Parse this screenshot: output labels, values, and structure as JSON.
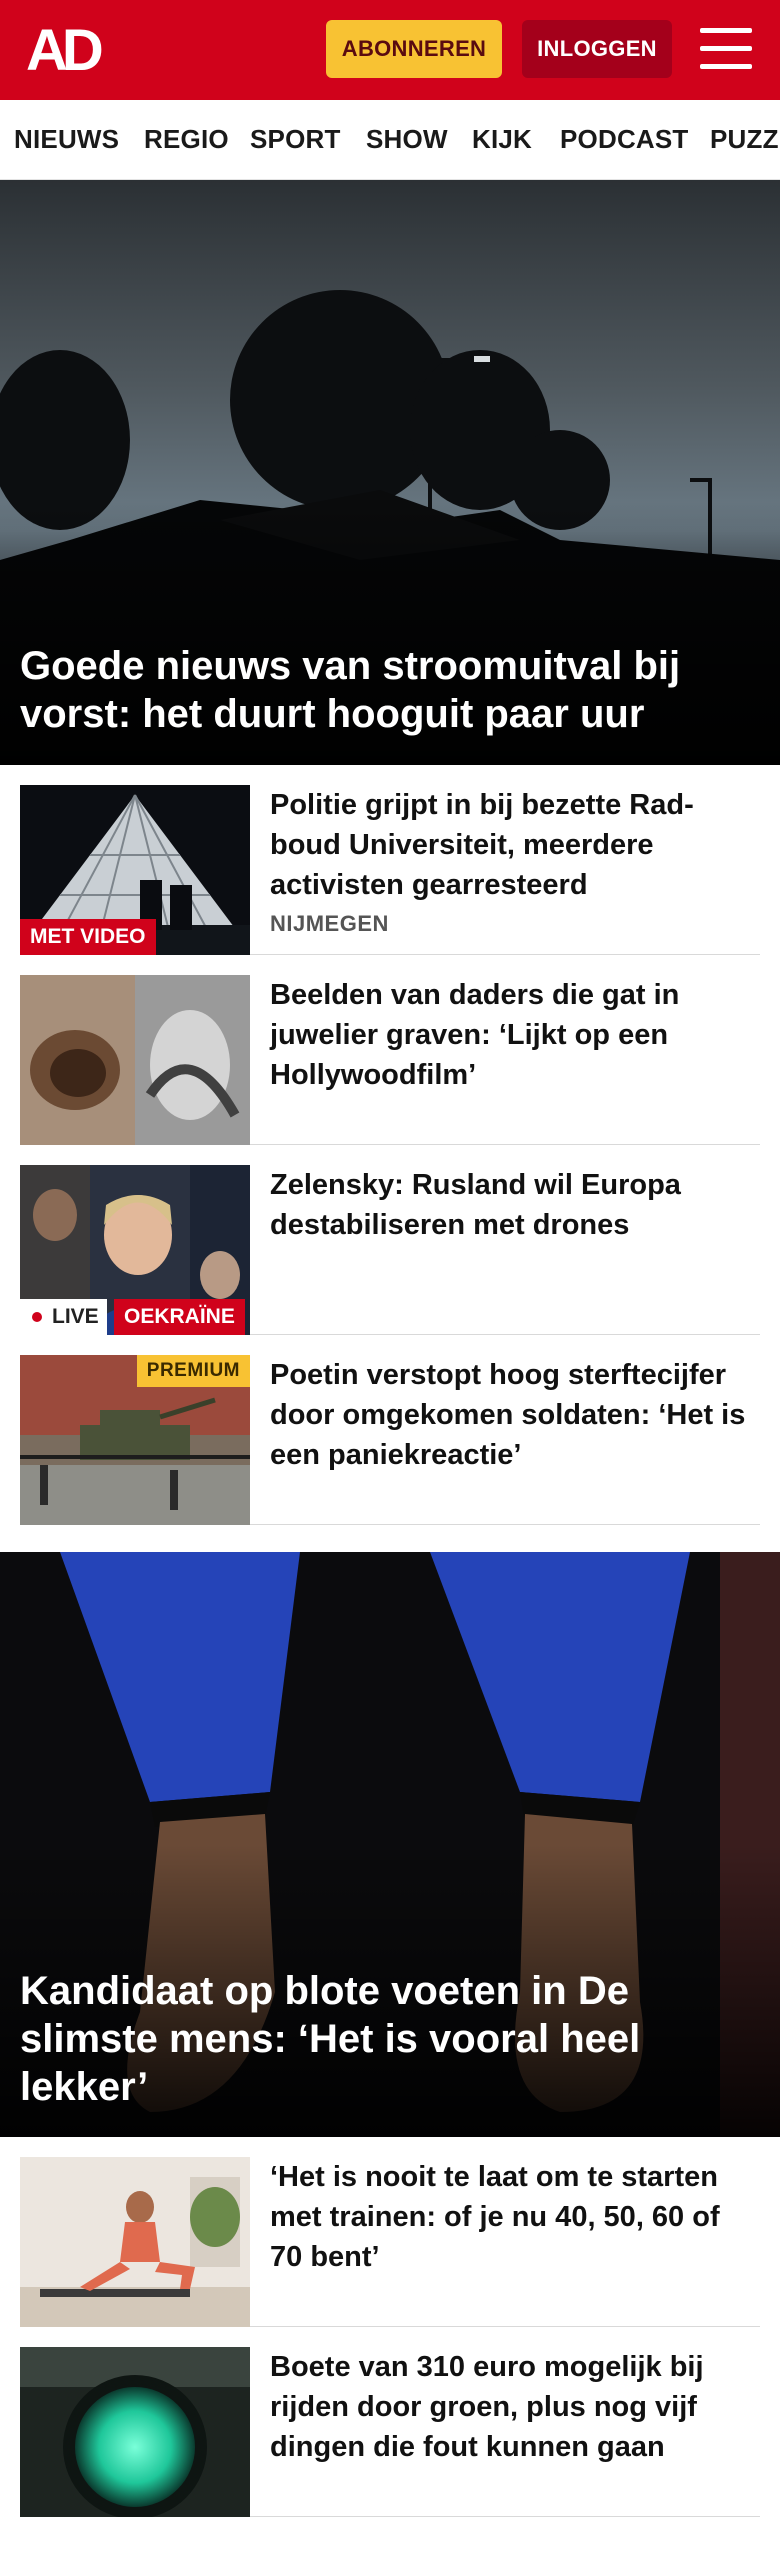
{
  "header": {
    "logo_text": "AD",
    "subscribe_label": "ABONNEREN",
    "login_label": "INLOGGEN",
    "brand_color": "#d0021b"
  },
  "nav": {
    "items": [
      "NIEUWS",
      "REGIO",
      "SPORT",
      "SHOW",
      "KIJK",
      "PODCAST",
      "PUZZ"
    ]
  },
  "hero1": {
    "headline": "Goede nieuws van stroomuitval bij vorst: het duurt hooguit paar uur"
  },
  "articles1": [
    {
      "title": "Politie grijpt in bij bezette Rad­boud Universiteit, meerdere activisten gearresteerd",
      "subtitle": "NIJMEGEN",
      "badge": "MET VIDEO"
    },
    {
      "title": "Beelden van daders die gat in juwelier graven: ‘Lijkt op een Hollywoodfilm’"
    },
    {
      "title": "Zelensky: Rusland wil Europa destabiliseren met drones",
      "live_label": "LIVE",
      "badge": "OEKRAÏNE"
    },
    {
      "title": "Poetin verstopt hoog sterftecij­fer door omgekomen soldaten: ‘Het is een paniekreactie’",
      "premium_label": "PREMIUM"
    }
  ],
  "hero2": {
    "headline": "Kandidaat op blote voeten in De slimste mens: ‘Het is vooral heel lekker’"
  },
  "articles2": [
    {
      "title": "‘Het is nooit te laat om te starten met trainen: of je nu 40, 50, 60 of 70 bent’"
    },
    {
      "title": "Boete van 310 euro mogelijk bij rijden door groen, plus nog vijf dingen die fout kunnen gaan"
    }
  ]
}
